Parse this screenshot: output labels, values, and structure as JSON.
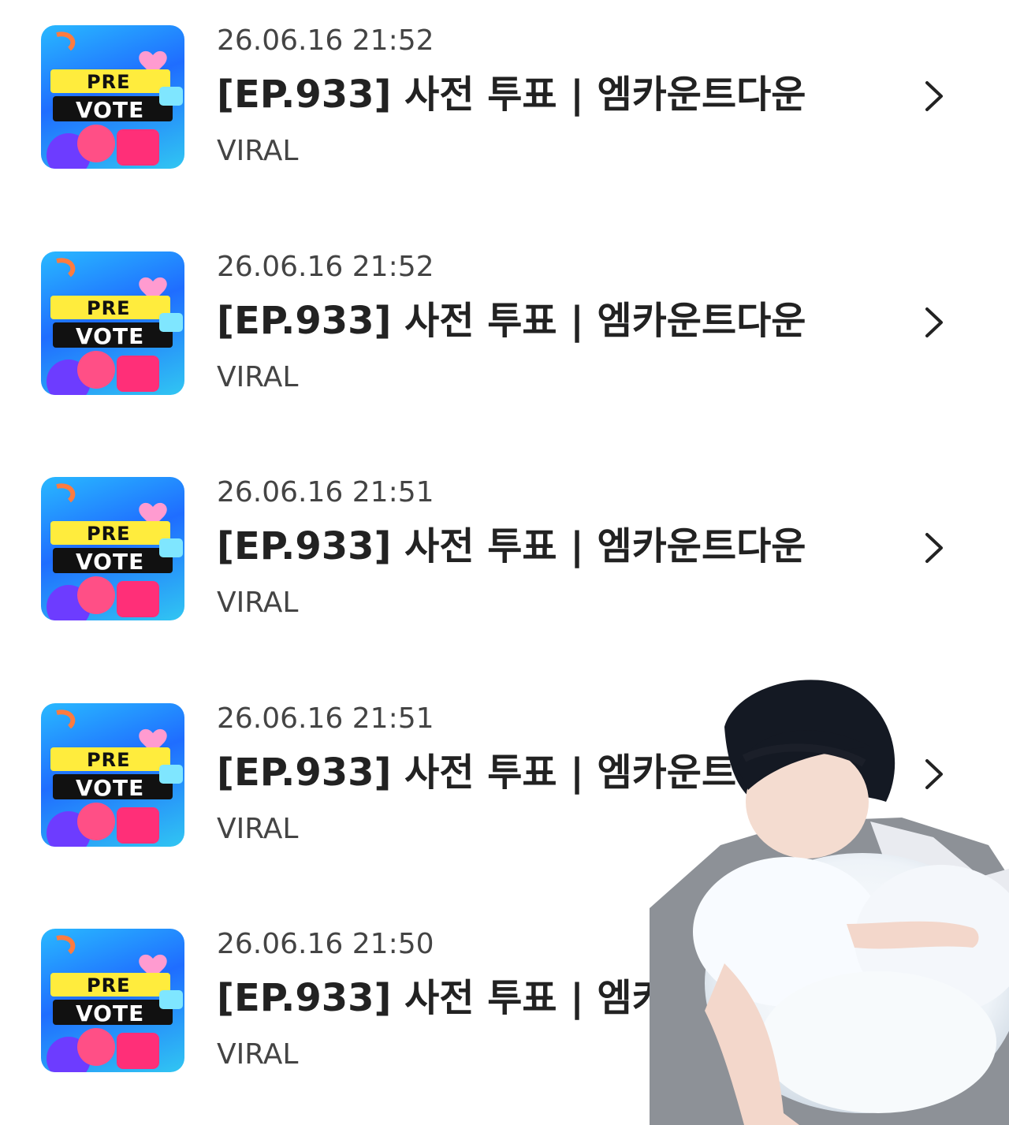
{
  "feed": {
    "items": [
      {
        "thumbnail": {
          "pre": "PRE",
          "vote": "VOTE"
        },
        "date": "26.06.16 21:52",
        "title": "[EP.933] 사전 투표 | 엠카운트다운",
        "source": "VIRAL"
      },
      {
        "thumbnail": {
          "pre": "PRE",
          "vote": "VOTE"
        },
        "date": "26.06.16 21:52",
        "title": "[EP.933] 사전 투표 | 엠카운트다운",
        "source": "VIRAL"
      },
      {
        "thumbnail": {
          "pre": "PRE",
          "vote": "VOTE"
        },
        "date": "26.06.16 21:51",
        "title": "[EP.933] 사전 투표 | 엠카운트다운",
        "source": "VIRAL"
      },
      {
        "thumbnail": {
          "pre": "PRE",
          "vote": "VOTE"
        },
        "date": "26.06.16 21:51",
        "title": "[EP.933] 사전 투표 | 엠카운트다운",
        "source": "VIRAL"
      },
      {
        "thumbnail": {
          "pre": "PRE",
          "vote": "VOTE"
        },
        "date": "26.06.16 21:50",
        "title": "[EP.933] 사전 투표 | 엠카운트다운",
        "source": "VIRAL"
      }
    ],
    "chevron_icon": "chevron-right-icon"
  },
  "colors": {
    "date_text": "#444444",
    "title_text": "#222222",
    "thumbnail_blue": "#1f6dff",
    "thumbnail_yellow": "#ffec3d",
    "thumbnail_pink": "#ff3f7f"
  }
}
